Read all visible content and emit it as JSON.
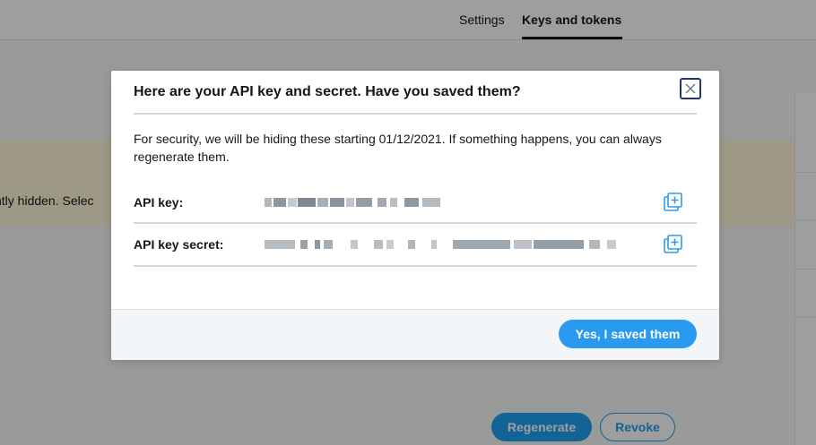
{
  "background": {
    "nav_tabs": [
      {
        "label": "Settings"
      },
      {
        "label": "Keys and tokens",
        "active": true
      }
    ],
    "notice_text": "ntly hidden. Selec",
    "buttons": {
      "regenerate": "Regenerate",
      "revoke": "Revoke"
    }
  },
  "modal": {
    "title": "Here are your API key and secret. Have you saved them?",
    "description": "For security, we will be hiding these starting 01/12/2021. If something happens, you can always regenerate them.",
    "fields": [
      {
        "label": "API key:",
        "value_redacted": true
      },
      {
        "label": "API key secret:",
        "value_redacted": true
      }
    ],
    "confirm_button": "Yes, I saved them"
  },
  "colors": {
    "accent": "#1da1f2",
    "primary_button": "#2a9af0",
    "close_border": "#1b3a6b",
    "overlay": "rgba(0,0,0,0.38)"
  },
  "icons": {
    "close": "close-icon",
    "copy": "copy-icon"
  }
}
